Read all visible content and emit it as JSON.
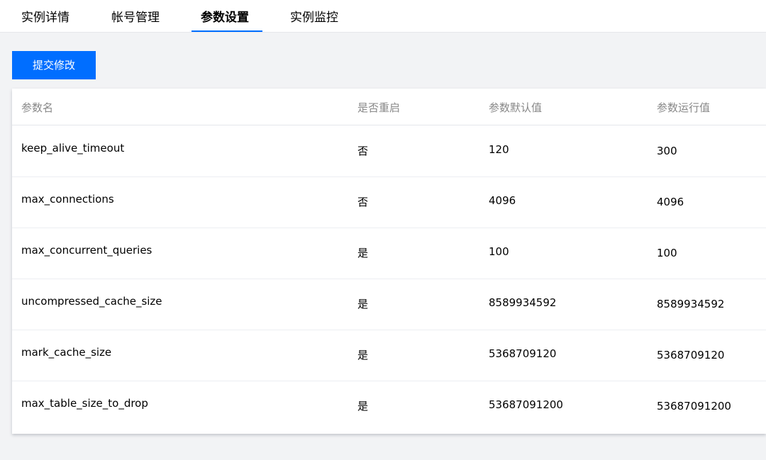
{
  "tabs": [
    {
      "label": "实例详情"
    },
    {
      "label": "帐号管理"
    },
    {
      "label": "参数设置",
      "active": true
    },
    {
      "label": "实例监控"
    }
  ],
  "toolbar": {
    "submit_label": "提交修改"
  },
  "table": {
    "columns": [
      "参数名",
      "是否重启",
      "参数默认值",
      "参数运行值"
    ],
    "rows": [
      {
        "name": "keep_alive_timeout",
        "restart": "否",
        "default": "120",
        "running": "300"
      },
      {
        "name": "max_connections",
        "restart": "否",
        "default": "4096",
        "running": "4096"
      },
      {
        "name": "max_concurrent_queries",
        "restart": "是",
        "default": "100",
        "running": "100"
      },
      {
        "name": "uncompressed_cache_size",
        "restart": "是",
        "default": "8589934592",
        "running": "8589934592"
      },
      {
        "name": "mark_cache_size",
        "restart": "是",
        "default": "5368709120",
        "running": "5368709120"
      },
      {
        "name": "max_table_size_to_drop",
        "restart": "是",
        "default": "53687091200",
        "running": "53687091200"
      }
    ]
  },
  "colors": {
    "accent": "#006eff",
    "page_bg": "#f2f3f5",
    "header_text": "#888888"
  }
}
